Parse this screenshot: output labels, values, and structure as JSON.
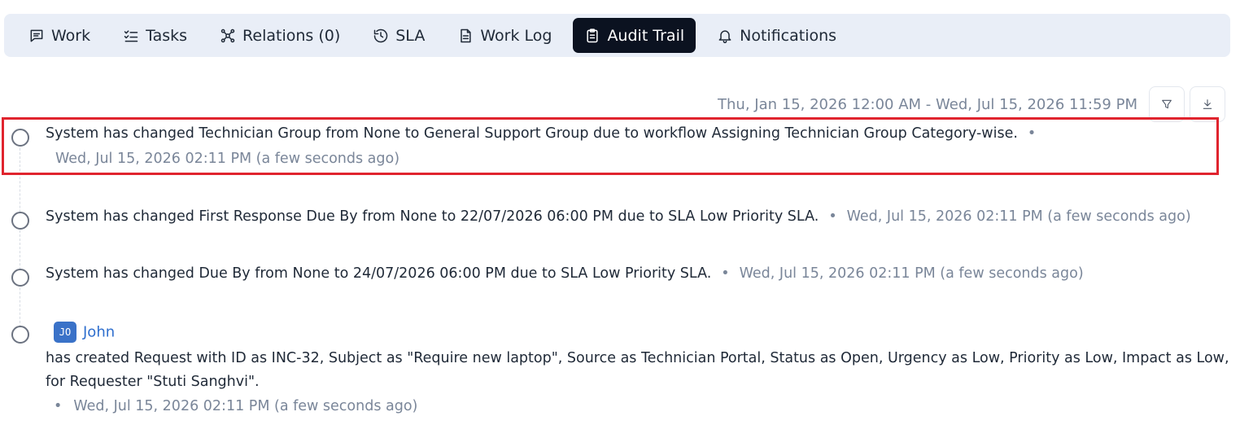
{
  "tabs": [
    {
      "label": "Work",
      "icon": "message-square-icon"
    },
    {
      "label": "Tasks",
      "icon": "checklist-icon"
    },
    {
      "label": "Relations (0)",
      "icon": "relations-icon"
    },
    {
      "label": "SLA",
      "icon": "history-icon"
    },
    {
      "label": "Work Log",
      "icon": "document-icon"
    },
    {
      "label": "Audit Trail",
      "icon": "clipboard-icon",
      "active": true
    },
    {
      "label": "Notifications",
      "icon": "bell-icon"
    }
  ],
  "date_range": "Thu, Jan 15, 2026 12:00 AM - Wed, Jul 15, 2026 11:59 PM",
  "entries": [
    {
      "text": "System has changed Technician Group from None to General Support Group due to workflow Assigning Technician Group Category-wise.",
      "separator": "•",
      "timestamp": "Wed, Jul 15, 2026 02:11 PM (a few seconds ago)"
    },
    {
      "text": "System has changed First Response Due By from None to 22/07/2026 06:00 PM due to SLA Low Priority SLA.",
      "separator": "•",
      "timestamp": "Wed, Jul 15, 2026 02:11 PM (a few seconds ago)"
    },
    {
      "text": "System has changed Due By from None to 24/07/2026 06:00 PM due to SLA Low Priority SLA.",
      "separator": "•",
      "timestamp": "Wed, Jul 15, 2026 02:11 PM (a few seconds ago)"
    },
    {
      "user_initials": "JO",
      "user_name": "John",
      "text": "has created Request with ID as INC-32, Subject as \"Require new laptop\", Source as Technician Portal, Status as Open, Urgency as Low, Priority as Low, Impact as Low, for Requester \"Stuti Sanghvi\".",
      "separator": "•",
      "timestamp": "Wed, Jul 15, 2026 02:11 PM (a few seconds ago)"
    }
  ],
  "colors": {
    "active_tab_bg": "#0b1220",
    "tabbar_bg": "#e9eef7",
    "highlight_border": "#e0242e",
    "timestamp": "#7a8699",
    "user_link": "#2f6fce",
    "avatar_bg": "#3a72c8"
  }
}
